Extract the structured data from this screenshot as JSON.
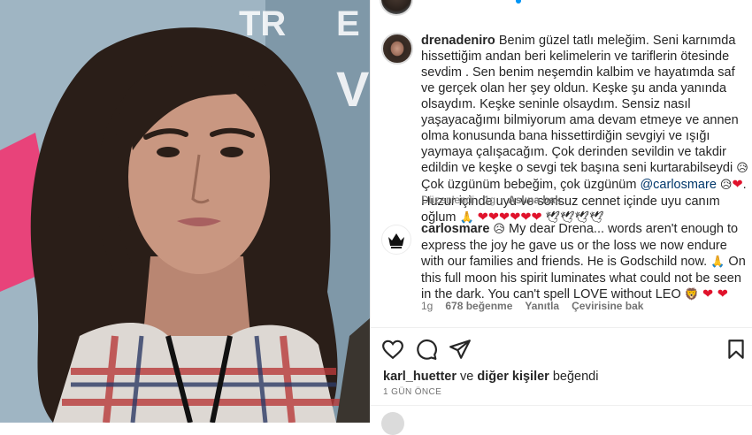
{
  "caption": {
    "username": "drenadeniro",
    "text_part1": "Benim güzel tatlı meleğim. Seni karnımda hissettiğim andan beri kelimelerin ve tariflerin ötesinde sevdim . Sen benim neşemdin kalbim ve hayatımda saf ve gerçek olan her şey oldun. Keşke şu anda yanında olsaydım. Keşke seninle olsaydım. Sensiz nasıl yaşayacağımı bilmiyorum ama devam etmeye ve annen olma konusunda bana hissettirdiğin sevgiyi ve ışığı yaymaya çalışacağım. Çok derinden sevildin ve takdir edildin ve keşke o sevgi tek başına seni kurtarabilseydi ",
    "emoji_sad1": "😥",
    "text_part2": "Çok üzgünüm bebeğim, çok üzgünüm ",
    "mention": "@carlosmare",
    "emoji_sad2": "😥",
    "hearts1": "❤",
    "text_part3": ". Huzur içinde uyu ve sonsuz cennet içinde uyu canım oğlum ",
    "emoji_pray": "🙏",
    "hearts2": "❤❤❤❤❤❤",
    "doves": "🕊🕊🕊🕊"
  },
  "caption_meta": {
    "edited": "Düzenlendi · 1g",
    "translate": "Aslına bak"
  },
  "reply": {
    "username": "carlosmare",
    "emoji_sad": "😥",
    "text_part1": " My dear Drena... words aren't enough to express the joy he gave us or the loss we now endure with our families and friends. He is Godschild now. ",
    "emoji_pray": "🙏",
    "text_part2": " On this full moon his spirit luminates what could not be seen in the dark. You can't spell LOVE without LEO ",
    "emoji_lion": "🦁",
    "hearts": "❤ ❤"
  },
  "reply_meta": {
    "age": "1g",
    "likes": "678 beğenme",
    "reply": "Yanıtla",
    "translate": "Çevirisine bak"
  },
  "actions": {
    "like": "heart-outline",
    "comment": "comment-bubble",
    "share": "paper-plane",
    "save": "bookmark"
  },
  "likes_line": {
    "user": "karl_huetter",
    "and": "ve",
    "others": "diğer kişiler",
    "liked": "beğendi"
  },
  "time_ago": "1 GÜN ÖNCE",
  "photo_sign": {
    "letters": "TRIBECA TV"
  },
  "colors": {
    "mention": "#00376b",
    "meta": "#737373",
    "heart": "#e0122b",
    "text": "#262626"
  }
}
